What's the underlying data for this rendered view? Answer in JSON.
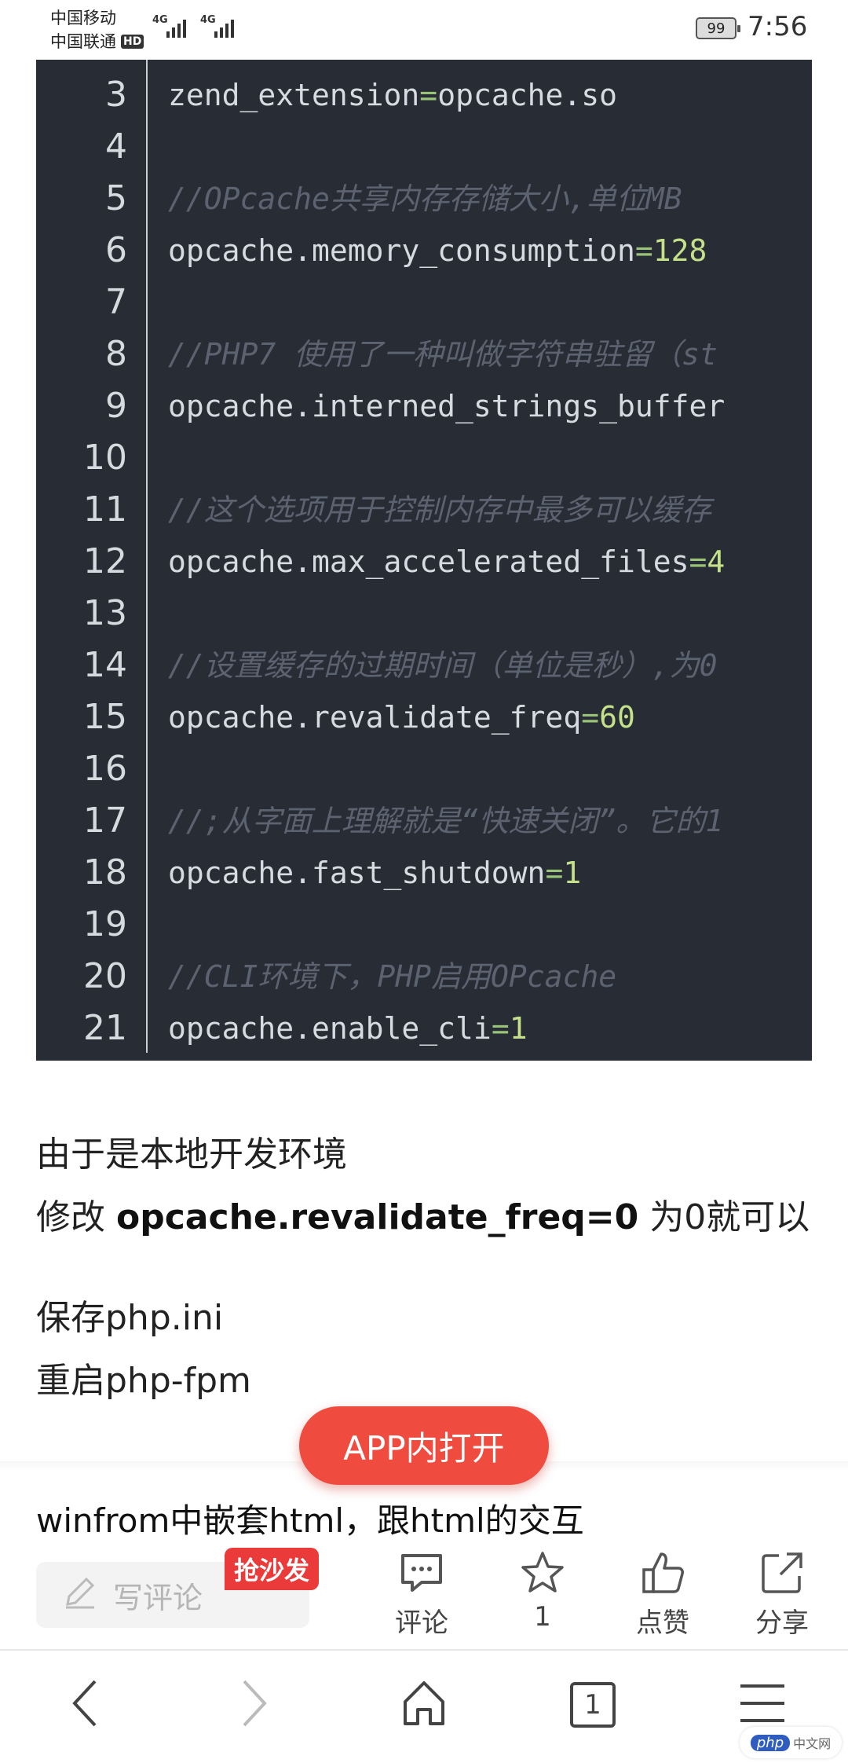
{
  "status_bar": {
    "carrier1": "中国移动",
    "carrier2": "中国联通",
    "hd": "HD",
    "net1": "4G",
    "net2": "4G",
    "battery": "99",
    "time": "7:56"
  },
  "code_lines": [
    {
      "n": "3",
      "key": "zend_extension",
      "eq": "=",
      "val": "opcache.so",
      "val_color": "key"
    },
    {
      "n": "4",
      "comment": ""
    },
    {
      "n": "5",
      "comment": "//OPcache共享内存存储大小,单位MB"
    },
    {
      "n": "6",
      "key": "opcache.memory_consumption",
      "eq": "=",
      "val": "128"
    },
    {
      "n": "7",
      "comment": ""
    },
    {
      "n": "8",
      "comment": "//PHP7 使用了一种叫做字符串驻留（st"
    },
    {
      "n": "9",
      "key": "opcache.interned_strings_buffer",
      "eq": "",
      "val": ""
    },
    {
      "n": "10",
      "comment": ""
    },
    {
      "n": "11",
      "comment": "//这个选项用于控制内存中最多可以缓存"
    },
    {
      "n": "12",
      "key": "opcache.max_accelerated_files",
      "eq": "=",
      "val": "4"
    },
    {
      "n": "13",
      "comment": ""
    },
    {
      "n": "14",
      "comment": "//设置缓存的过期时间（单位是秒）,为0"
    },
    {
      "n": "15",
      "key": "opcache.revalidate_freq",
      "eq": "=",
      "val": "60"
    },
    {
      "n": "16",
      "comment": ""
    },
    {
      "n": "17",
      "comment": "//;从字面上理解就是“快速关闭”。它的1"
    },
    {
      "n": "18",
      "key": "opcache.fast_shutdown",
      "eq": "=",
      "val": "1"
    },
    {
      "n": "19",
      "comment": ""
    },
    {
      "n": "20",
      "comment": "//CLI环境下，PHP启用OPcache"
    },
    {
      "n": "21",
      "key": "opcache.enable_cli",
      "eq": "=",
      "val": "1"
    }
  ],
  "article": {
    "line1": "由于是本地开发环境",
    "line2_prefix": "修改 ",
    "line2_bold": "opcache.revalidate_freq=0",
    "line2_suffix": " 为0就可以",
    "line3": "保存php.ini",
    "line4": "重启php-fpm"
  },
  "app_button": "APP内打开",
  "related_title": "winfrom中嵌套html，跟html的交互",
  "comment_bar": {
    "placeholder": "写评论",
    "sofa_badge": "抢沙发",
    "comment_label": "评论",
    "favorite_count": "1",
    "like_label": "点赞",
    "share_label": "分享"
  },
  "bottom_nav": {
    "tab_count": "1"
  },
  "watermark": {
    "logo": "php",
    "text": "中文网"
  },
  "colors": {
    "code_bg": "#282c34",
    "accent_red": "#ef4b3f",
    "badge_red": "#ea3a3a"
  }
}
